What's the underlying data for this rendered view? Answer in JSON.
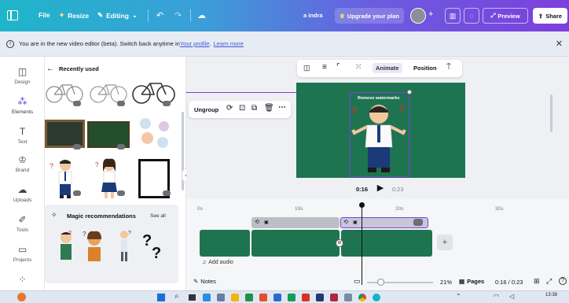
{
  "topbar": {
    "file": "File",
    "resize": "Resize",
    "editing": "Editing",
    "username": "a indra",
    "upgrade": "Upgrade your plan",
    "preview": "Preview",
    "share": "Share"
  },
  "banner": {
    "text": "You are in the new video editor (beta). Switch back anytime in ",
    "profile_link": "Your profile",
    "period": ".",
    "learn_more": "Learn more"
  },
  "siderail": {
    "items": [
      {
        "label": "Design",
        "icon": "layout-icon"
      },
      {
        "label": "Elements",
        "icon": "elements-icon"
      },
      {
        "label": "Text",
        "icon": "text-icon"
      },
      {
        "label": "Brand",
        "icon": "brand-icon"
      },
      {
        "label": "Uploads",
        "icon": "upload-icon"
      },
      {
        "label": "Tools",
        "icon": "tools-icon"
      },
      {
        "label": "Projects",
        "icon": "folder-icon"
      }
    ]
  },
  "panel": {
    "header": "Recently used",
    "magic_title": "Magic recommendations",
    "see_all": "See all"
  },
  "toolbar": {
    "animate": "Animate",
    "position": "Position"
  },
  "float_menu": {
    "ungroup": "Ungroup"
  },
  "canvas": {
    "watermark": "Remove watermarks",
    "bg_color": "#1e7450"
  },
  "playback": {
    "current": "0:16",
    "total": "0:23"
  },
  "ruler": {
    "ticks": [
      "0s",
      "10s",
      "20s",
      "30s"
    ]
  },
  "timeline": {
    "add_audio": "Add audio"
  },
  "footer": {
    "notes": "Notes",
    "zoom": "21%",
    "pages": "Pages",
    "time": "0:16 / 0:23"
  },
  "taskbar": {
    "clock": "13:38"
  }
}
